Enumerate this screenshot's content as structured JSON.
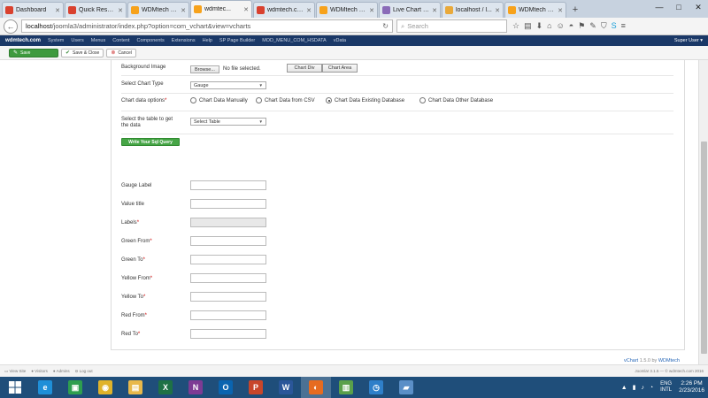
{
  "browser": {
    "tabs": [
      {
        "label": "Dashboard",
        "icon_color": "#d9412f",
        "active": false
      },
      {
        "label": "Quick Reserv...",
        "icon_color": "#d9412f",
        "active": false
      },
      {
        "label": "WDMtech S...",
        "icon_color": "#f7a21b",
        "active": false
      },
      {
        "label": "wdmtec...",
        "icon_color": "#f7a21b",
        "active": true
      },
      {
        "label": "wdmtech.co...",
        "icon_color": "#d9412f",
        "active": false
      },
      {
        "label": "WDMtech S...",
        "icon_color": "#f7a21b",
        "active": false
      },
      {
        "label": "Live Chart Pr...",
        "icon_color": "#8a6bb8",
        "active": false
      },
      {
        "label": "localhost / l...",
        "icon_color": "#e9a93a",
        "active": false
      },
      {
        "label": "WDMtech S...",
        "icon_color": "#f7a21b",
        "active": false
      }
    ],
    "url_host": "localhost",
    "url_path": "/joomla3/administrator/index.php?option=com_vchart&view=vcharts",
    "search_placeholder": "Search"
  },
  "adminbar": {
    "brand": "wdmtech.com",
    "menus": [
      "System",
      "Users",
      "Menus",
      "Content",
      "Components",
      "Extensions",
      "Help",
      "SP Page Builder",
      "MOD_MENU_COM_HSDATA",
      "vData"
    ],
    "user": "Super User ▾"
  },
  "toolbar": {
    "save": "Save",
    "save_close": "Save & Close",
    "cancel": "Cancel"
  },
  "form": {
    "background_image_label": "Background Image",
    "browse_label": "Browse...",
    "no_file": "No file selected.",
    "chart_div": "Chart Div",
    "chart_area": "Chart Area",
    "chart_type_label": "Select Chart Type",
    "chart_type_value": "Gauge",
    "data_options_label": "Chart data options",
    "data_options": [
      {
        "label": "Chart Data Manually",
        "checked": false
      },
      {
        "label": "Chart Data from CSV",
        "checked": false
      },
      {
        "label": "Chart Data Existing Database",
        "checked": true
      },
      {
        "label": "Chart Data Other Database",
        "checked": false
      }
    ],
    "table_label_line1": "Select the table to get",
    "table_label_line2": "the data",
    "table_value": "Select Table",
    "sql_button": "Write Your Sql Query",
    "fields": [
      {
        "label": "Gauge Label",
        "required": false,
        "disabled": false
      },
      {
        "label": "Value title",
        "required": false,
        "disabled": false
      },
      {
        "label": "Labels",
        "required": true,
        "disabled": true
      },
      {
        "label": "Green From",
        "required": true,
        "disabled": false
      },
      {
        "label": "Green To",
        "required": true,
        "disabled": false
      },
      {
        "label": "Yellow From",
        "required": true,
        "disabled": false
      },
      {
        "label": "Yellow To",
        "required": true,
        "disabled": false
      },
      {
        "label": "Red From",
        "required": true,
        "disabled": false
      },
      {
        "label": "Red To",
        "required": true,
        "disabled": false
      }
    ],
    "required_mark": "*"
  },
  "credit": {
    "product": "vChart",
    "version": "1.5.0 by",
    "vendor": "WDMtech"
  },
  "statusbar": {
    "items": [
      "View Site",
      "Visitors",
      "Admins",
      "Log out"
    ],
    "version": "Joomla! 3.1.5 — © wdmtech.com 2016"
  },
  "taskbar": {
    "apps": [
      {
        "name": "ie-icon",
        "glyph": "e",
        "color": "#1f8fd8"
      },
      {
        "name": "store-icon",
        "glyph": "▣",
        "color": "#2e9e4f"
      },
      {
        "name": "chrome-icon",
        "glyph": "◉",
        "color": "#e0b32a"
      },
      {
        "name": "explorer-icon",
        "glyph": "▤",
        "color": "#e8b84a"
      },
      {
        "name": "excel-icon",
        "glyph": "X",
        "color": "#1e7145"
      },
      {
        "name": "onenote-icon",
        "glyph": "N",
        "color": "#7d3b94"
      },
      {
        "name": "outlook-icon",
        "glyph": "O",
        "color": "#0a64b0"
      },
      {
        "name": "powerpoint-icon",
        "glyph": "P",
        "color": "#c8462a"
      },
      {
        "name": "word-icon",
        "glyph": "W",
        "color": "#2a5699"
      },
      {
        "name": "firefox-icon",
        "glyph": "◐",
        "color": "#e66b20"
      },
      {
        "name": "chart-app-icon",
        "glyph": "▥",
        "color": "#5aa04a"
      },
      {
        "name": "clock-app-icon",
        "glyph": "◷",
        "color": "#2f7fc9"
      },
      {
        "name": "notes-app-icon",
        "glyph": "▰",
        "color": "#5b8fc7"
      }
    ],
    "active_index": 9,
    "lang1": "ENG",
    "lang2": "INTL",
    "time": "2:26 PM",
    "date": "2/23/2016"
  }
}
